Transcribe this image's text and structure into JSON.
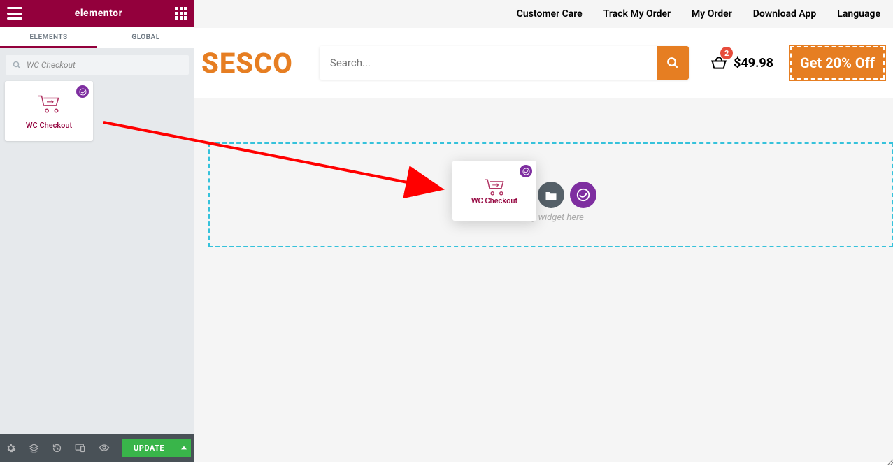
{
  "panel": {
    "title": "elementor",
    "tabs": {
      "elements": "ELEMENTS",
      "global": "GLOBAL"
    },
    "search_value": "WC Checkout",
    "widget_label": "WC Checkout",
    "update_label": "UPDATE"
  },
  "topnav": {
    "customer_care": "Customer Care",
    "track_order": "Track My Order",
    "my_order": "My Order",
    "download_app": "Download App",
    "language": "Language"
  },
  "header": {
    "brand": "SESCO",
    "search_placeholder": "Search...",
    "cart_count": "2",
    "cart_total": "$49.98",
    "promo": "Get 20% Off"
  },
  "dropzone": {
    "hint": "Drag widget here",
    "ghost_label": "WC Checkout"
  },
  "colors": {
    "elementor_red": "#93003c",
    "accent_orange": "#e67e22",
    "dropzone_blue": "#35c2db",
    "update_green": "#39b54a",
    "badge_purple": "#7e2ea0"
  }
}
